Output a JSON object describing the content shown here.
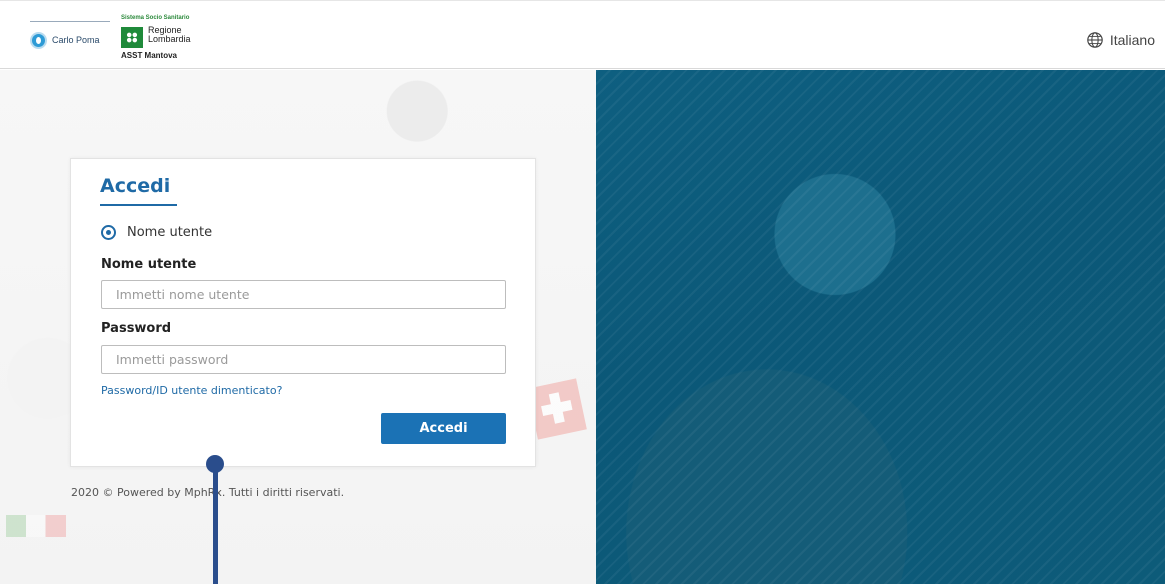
{
  "header": {
    "logo_hospital_name": "Carlo Poma",
    "logo_system_text": "Sistema Socio Sanitario",
    "logo_region_line1": "Regione",
    "logo_region_line2": "Lombardia",
    "logo_asst_text": "ASST Mantova",
    "language_label": "Italiano"
  },
  "login": {
    "title": "Accedi",
    "radio_label": "Nome utente",
    "username_label": "Nome utente",
    "username_placeholder": "Immetti nome utente",
    "username_value": "",
    "password_label": "Password",
    "password_placeholder": "Immetti password",
    "password_value": "",
    "forgot_link": "Password/ID utente dimenticato?",
    "submit_label": "Accedi"
  },
  "footer": {
    "text": "2020 © Powered by MphRx. Tutti i diritti riservati."
  },
  "colors": {
    "accent": "#1f6aa6",
    "button": "#1b72b5",
    "panel": "#0b5878",
    "marker": "#2a4d8c"
  },
  "icons": {
    "language": "globe-icon"
  }
}
